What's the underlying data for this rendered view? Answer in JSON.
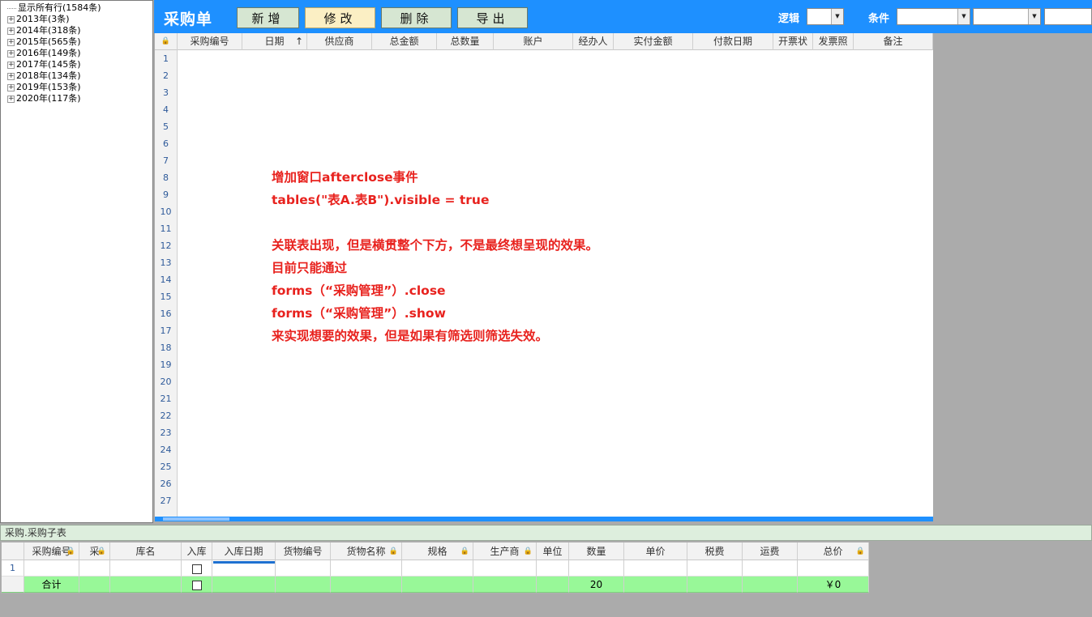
{
  "tree": {
    "root": "显示所有行(1584条)",
    "items": [
      "2013年(3条)",
      "2014年(318条)",
      "2015年(565条)",
      "2016年(149条)",
      "2017年(145条)",
      "2018年(134条)",
      "2019年(153条)",
      "2020年(117条)"
    ]
  },
  "header": {
    "title": "采购单",
    "buttons": [
      "新增",
      "修改",
      "删除",
      "导出"
    ],
    "logic_label": "逻辑",
    "condition_label": "条件"
  },
  "grid": {
    "columns": [
      "采购编号",
      "日期",
      "供应商",
      "总金额",
      "总数量",
      "账户",
      "经办人",
      "实付金额",
      "付款日期",
      "开票状",
      "发票照",
      "备注"
    ],
    "sort_arrow": "↑",
    "row_numbers": [
      "1",
      "2",
      "3",
      "4",
      "5",
      "6",
      "7",
      "8",
      "9",
      "10",
      "11",
      "12",
      "13",
      "14",
      "15",
      "16",
      "17",
      "18",
      "19",
      "20",
      "21",
      "22",
      "23",
      "24",
      "25",
      "26",
      "27"
    ]
  },
  "overlay": {
    "lines": [
      "增加窗口afterclose事件",
      "tables(\"表A.表B\").visible = true",
      "",
      "关联表出现，但是横贯整个下方，不是最终想呈现的效果。",
      "目前只能通过",
      "forms（“采购管理”）.close",
      "forms（“采购管理”）.show",
      "来实现想要的效果，但是如果有筛选则筛选失效。"
    ],
    "color": "#e8221e"
  },
  "detail": {
    "title": "采购.采购子表",
    "columns": [
      "采购编号",
      "采",
      "库名",
      "入库",
      "入库日期",
      "货物编号",
      "货物名称",
      "规格",
      "生产商",
      "单位",
      "数量",
      "单价",
      "税费",
      "运费",
      "总价"
    ],
    "row_number": "1",
    "total_label": "合计",
    "total_quantity": "20",
    "total_price": "￥0"
  },
  "colors": {
    "accent": "#1e90ff",
    "total_row": "#98f898",
    "active_button": "#fbefc4"
  }
}
